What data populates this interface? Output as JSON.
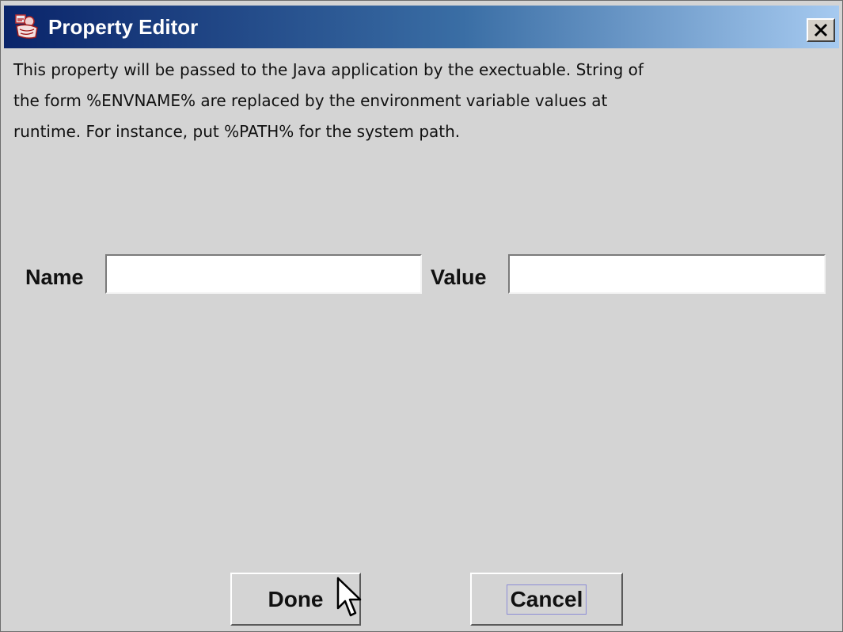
{
  "window": {
    "title": "Property Editor",
    "title_icon": "java-app-icon",
    "close_icon": "close-x-icon",
    "title_gradient": [
      "#0a246a",
      "#3a6ea5",
      "#a6caf0"
    ]
  },
  "description": {
    "line1": "This property will be passed to the Java application by the exectuable. String of",
    "line2": "the form %ENVNAME% are replaced by the environment variable values at",
    "line3": "runtime. For instance, put %PATH% for the system path."
  },
  "form": {
    "name_label": "Name",
    "name_value": "",
    "value_label": "Value",
    "value_value": ""
  },
  "buttons": {
    "done": "Done",
    "cancel": "Cancel"
  },
  "cursor_icon": "mouse-pointer-icon"
}
